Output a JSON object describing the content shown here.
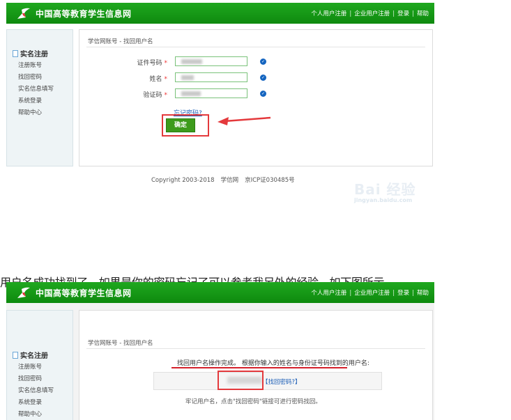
{
  "colors": {
    "brand_green": "#129312",
    "accent_red": "#e4393c",
    "link_blue": "#1a5db6",
    "check_blue": "#1565c0"
  },
  "header": {
    "title": "中国高等教育学生信息网",
    "links": [
      "个人用户注册",
      "企业用户注册",
      "登录",
      "帮助"
    ],
    "separator": "|",
    "logo_icon": "chsi-logo-icon"
  },
  "sidebar": {
    "section": "实名注册",
    "items": [
      "注册账号",
      "找回密码",
      "实名信息填写",
      "系统登录",
      "帮助中心"
    ]
  },
  "form": {
    "breadcrumb": "学信网账号 - 找回用户名",
    "fields": [
      {
        "label": "证件号码",
        "required": "*",
        "value": ""
      },
      {
        "label": "姓名",
        "required": "*",
        "value": ""
      },
      {
        "label": "验证码",
        "required": "*",
        "value": ""
      }
    ],
    "forgot_link": "忘记密码?",
    "submit_label": "确定"
  },
  "footer": {
    "copyright": "Copyright 2003-2018",
    "site": "学信网",
    "icp": "京ICP证030485号"
  },
  "watermark": {
    "text": "Bai 经验",
    "url": "jingyan.baidu.com"
  },
  "caption": "用户名成功找到了，如果是你的密码忘记了可以参考我另外的经验，如下图所示",
  "result": {
    "breadcrumb": "学信网账号 - 找回用户名",
    "notice": "找回用户名操作完成。 根据你输入的姓名与身份证号码找到的用户名:",
    "find_password_link": "【找回密码?】",
    "remember_text": "牢记用户名，点击\"找回密码\"链接可进行密码找回。"
  }
}
